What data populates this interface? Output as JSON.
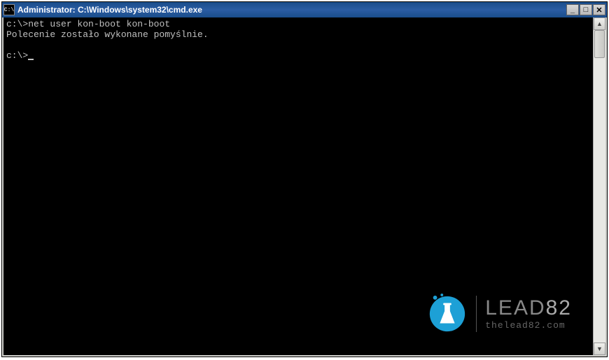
{
  "window": {
    "title": "Administrator: C:\\Windows\\system32\\cmd.exe",
    "icon_label": "C:\\"
  },
  "terminal": {
    "prompt1": "c:\\>",
    "command1": "net user kon-boot kon-boot",
    "output1": "Polecenie zostało wykonane pomyślnie.",
    "prompt2": "c:\\>"
  },
  "watermark": {
    "brand_a": "LEAD",
    "brand_b": "82",
    "url": "thelead82.com"
  },
  "titlebar_buttons": {
    "minimize": "_",
    "maximize": "□",
    "close": "✕"
  },
  "scrollbar": {
    "up": "▲",
    "down": "▼"
  }
}
